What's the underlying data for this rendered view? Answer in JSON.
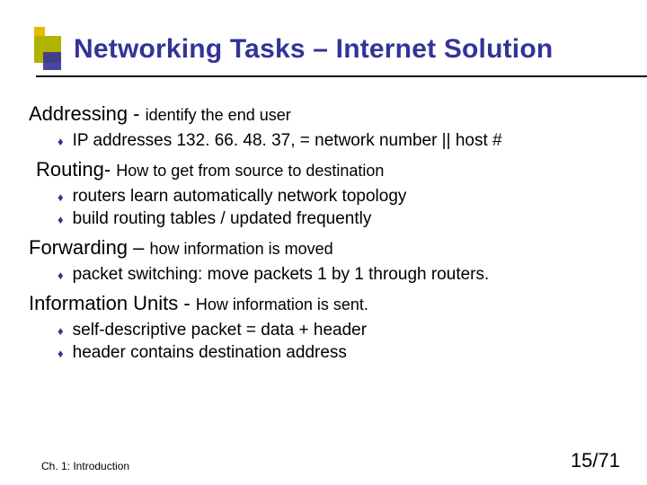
{
  "title": "Networking Tasks – Internet Solution",
  "sections": [
    {
      "heading_main": "Addressing - ",
      "heading_sub": "identify the end user",
      "indent": false,
      "bullets": [
        "IP addresses 132. 66. 48. 37, = network number || host #"
      ]
    },
    {
      "heading_main": "Routing- ",
      "heading_sub": "How to get from source to destination",
      "indent": true,
      "bullets": [
        "routers learn automatically network topology",
        "build routing tables / updated frequently"
      ]
    },
    {
      "heading_main": "Forwarding – ",
      "heading_sub": "how information is moved",
      "indent": false,
      "bullets": [
        "packet switching: move packets 1 by 1 through routers."
      ]
    },
    {
      "heading_main": "Information Units - ",
      "heading_sub": "How information is sent.",
      "indent": false,
      "bullets": [
        "self-descriptive packet = data + header",
        "header contains destination address"
      ]
    }
  ],
  "footer": {
    "chapter": "Ch. 1: Introduction",
    "page": "15/71"
  }
}
